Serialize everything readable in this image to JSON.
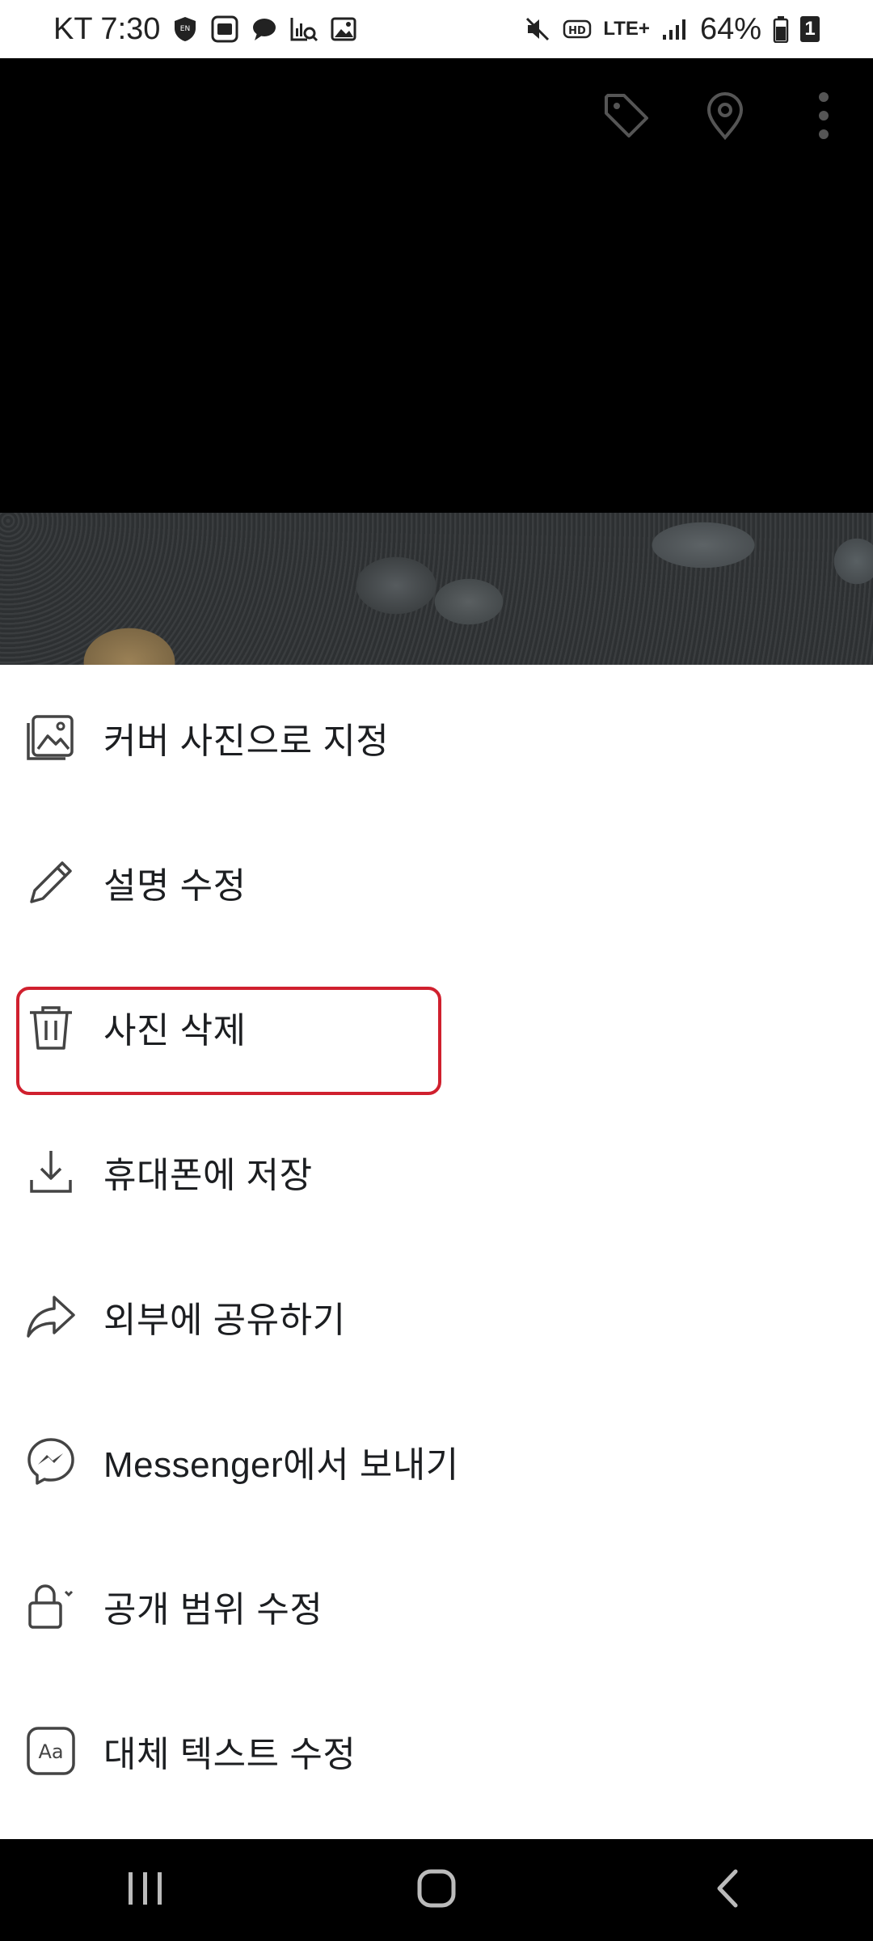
{
  "status_bar": {
    "carrier_time": "KT 7:30",
    "network": "LTE+",
    "battery": "64%",
    "sim": "1"
  },
  "photo_toolbar": {
    "icons": [
      "tag-icon",
      "location-pin-icon",
      "more-vertical-icon"
    ]
  },
  "menu": {
    "items": [
      {
        "label": "커버 사진으로 지정",
        "icon": "cover-photo-icon"
      },
      {
        "label": "설명 수정",
        "icon": "pencil-icon"
      },
      {
        "label": "사진 삭제",
        "icon": "trash-icon"
      },
      {
        "label": "휴대폰에 저장",
        "icon": "download-icon"
      },
      {
        "label": "외부에 공유하기",
        "icon": "share-arrow-icon"
      },
      {
        "label": "Messenger에서 보내기",
        "icon": "messenger-icon"
      },
      {
        "label": "공개 범위 수정",
        "icon": "lock-icon"
      },
      {
        "label": "대체 텍스트 수정",
        "icon": "alt-text-icon"
      }
    ],
    "highlight_color": "#d0202e"
  },
  "nav_bar": {
    "buttons": [
      "recent-apps-icon",
      "home-icon",
      "back-icon"
    ]
  }
}
